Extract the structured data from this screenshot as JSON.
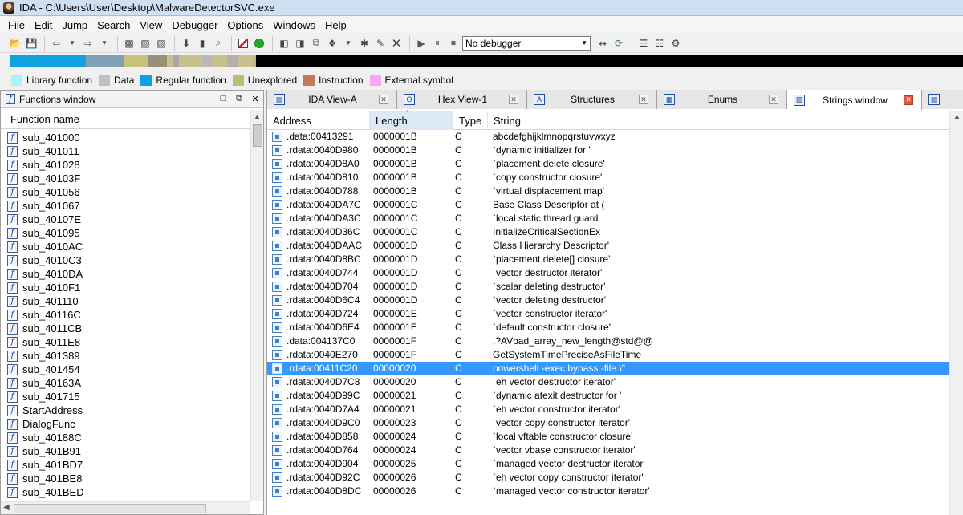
{
  "window": {
    "title": "IDA - C:\\Users\\User\\Desktop\\MalwareDetectorSVC.exe",
    "icon": "app-avatar-icon"
  },
  "menu": [
    "File",
    "Edit",
    "Jump",
    "Search",
    "View",
    "Debugger",
    "Options",
    "Windows",
    "Help"
  ],
  "toolbar": {
    "debugger_select": "No debugger"
  },
  "navband": {
    "segments": [
      {
        "kind": "regular",
        "from": 0.0,
        "to": 0.08,
        "color": "#11a1e0"
      },
      {
        "kind": "mixed",
        "from": 0.08,
        "to": 0.12,
        "color": "#7fa0b5"
      },
      {
        "kind": "unexplored",
        "from": 0.12,
        "to": 0.145,
        "color": "#c8c27c"
      },
      {
        "kind": "mixed",
        "from": 0.145,
        "to": 0.165,
        "color": "#9a8f7a"
      },
      {
        "kind": "unexplored",
        "from": 0.165,
        "to": 0.255,
        "color": "#c9c18d"
      },
      {
        "kind": "data",
        "from": 0.172,
        "to": 0.178,
        "color": "#a9a9a9"
      },
      {
        "kind": "data",
        "from": 0.2,
        "to": 0.212,
        "color": "#b8b8b8"
      },
      {
        "kind": "data",
        "from": 0.228,
        "to": 0.24,
        "color": "#b0b0b0"
      },
      {
        "kind": "unexplored",
        "from": 0.255,
        "to": 0.258,
        "color": "#c2b878"
      }
    ]
  },
  "legend": [
    {
      "label": "Library function",
      "color": "#aef0f8"
    },
    {
      "label": "Data",
      "color": "#c0c0c0"
    },
    {
      "label": "Regular function",
      "color": "#0aa2e8"
    },
    {
      "label": "Unexplored",
      "color": "#bfbd74"
    },
    {
      "label": "Instruction",
      "color": "#c07a58"
    },
    {
      "label": "External symbol",
      "color": "#f7a8f0"
    }
  ],
  "functions_window": {
    "title": "Functions window",
    "column": "Function name",
    "items": [
      "sub_401000",
      "sub_401011",
      "sub_401028",
      "sub_40103F",
      "sub_401056",
      "sub_401067",
      "sub_40107E",
      "sub_401095",
      "sub_4010AC",
      "sub_4010C3",
      "sub_4010DA",
      "sub_4010F1",
      "sub_401110",
      "sub_40116C",
      "sub_4011CB",
      "sub_4011E8",
      "sub_401389",
      "sub_401454",
      "sub_40163A",
      "sub_401715",
      "StartAddress",
      "DialogFunc",
      "sub_40188C",
      "sub_401B91",
      "sub_401BD7",
      "sub_401BE8",
      "sub_401BED"
    ]
  },
  "tabs": [
    {
      "label": "IDA View-A",
      "icon": "code-view-icon",
      "active": false
    },
    {
      "label": "Hex View-1",
      "icon": "hex-view-icon",
      "active": false
    },
    {
      "label": "Structures",
      "icon": "structures-icon",
      "active": false
    },
    {
      "label": "Enums",
      "icon": "enums-icon",
      "active": false
    },
    {
      "label": "Strings window",
      "icon": "strings-icon",
      "active": true
    }
  ],
  "strings_window": {
    "columns": [
      "Address",
      "Length",
      "Type",
      "String"
    ],
    "sorted_column": "Length",
    "partial_top_row": ".data:00413291 partial",
    "rows": [
      {
        "address": ".data:00413291",
        "length": "0000001B",
        "type": "C",
        "string": "abcdefghijklmnopqrstuvwxyz"
      },
      {
        "address": ".rdata:0040D980",
        "length": "0000001B",
        "type": "C",
        "string": "`dynamic initializer for '"
      },
      {
        "address": ".rdata:0040D8A0",
        "length": "0000001B",
        "type": "C",
        "string": "`placement delete closure'"
      },
      {
        "address": ".rdata:0040D810",
        "length": "0000001B",
        "type": "C",
        "string": "`copy constructor closure'"
      },
      {
        "address": ".rdata:0040D788",
        "length": "0000001B",
        "type": "C",
        "string": "`virtual displacement map'"
      },
      {
        "address": ".rdata:0040DA7C",
        "length": "0000001C",
        "type": "C",
        "string": " Base Class Descriptor at ("
      },
      {
        "address": ".rdata:0040DA3C",
        "length": "0000001C",
        "type": "C",
        "string": "`local static thread guard'"
      },
      {
        "address": ".rdata:0040D36C",
        "length": "0000001C",
        "type": "C",
        "string": "InitializeCriticalSectionEx"
      },
      {
        "address": ".rdata:0040DAAC",
        "length": "0000001D",
        "type": "C",
        "string": " Class Hierarchy Descriptor'"
      },
      {
        "address": ".rdata:0040D8BC",
        "length": "0000001D",
        "type": "C",
        "string": "`placement delete[] closure'"
      },
      {
        "address": ".rdata:0040D744",
        "length": "0000001D",
        "type": "C",
        "string": "`vector destructor iterator'"
      },
      {
        "address": ".rdata:0040D704",
        "length": "0000001D",
        "type": "C",
        "string": "`scalar deleting destructor'"
      },
      {
        "address": ".rdata:0040D6C4",
        "length": "0000001D",
        "type": "C",
        "string": "`vector deleting destructor'"
      },
      {
        "address": ".rdata:0040D724",
        "length": "0000001E",
        "type": "C",
        "string": "`vector constructor iterator'"
      },
      {
        "address": ".rdata:0040D6E4",
        "length": "0000001E",
        "type": "C",
        "string": "`default constructor closure'"
      },
      {
        "address": ".data:004137C0",
        "length": "0000001F",
        "type": "C",
        "string": ".?AVbad_array_new_length@std@@"
      },
      {
        "address": ".rdata:0040E270",
        "length": "0000001F",
        "type": "C",
        "string": "GetSystemTimePreciseAsFileTime"
      },
      {
        "address": ".rdata:00411C20",
        "length": "00000020",
        "type": "C",
        "string": "powershell -exec bypass -file \\\"",
        "selected": true
      },
      {
        "address": ".rdata:0040D7C8",
        "length": "00000020",
        "type": "C",
        "string": "`eh vector destructor iterator'"
      },
      {
        "address": ".rdata:0040D99C",
        "length": "00000021",
        "type": "C",
        "string": "`dynamic atexit destructor for '"
      },
      {
        "address": ".rdata:0040D7A4",
        "length": "00000021",
        "type": "C",
        "string": "`eh vector constructor iterator'"
      },
      {
        "address": ".rdata:0040D9C0",
        "length": "00000023",
        "type": "C",
        "string": "`vector copy constructor iterator'"
      },
      {
        "address": ".rdata:0040D858",
        "length": "00000024",
        "type": "C",
        "string": "`local vftable constructor closure'"
      },
      {
        "address": ".rdata:0040D764",
        "length": "00000024",
        "type": "C",
        "string": "`vector vbase constructor iterator'"
      },
      {
        "address": ".rdata:0040D904",
        "length": "00000025",
        "type": "C",
        "string": "`managed vector destructor iterator'"
      },
      {
        "address": ".rdata:0040D92C",
        "length": "00000026",
        "type": "C",
        "string": "`eh vector copy constructor iterator'"
      },
      {
        "address": ".rdata:0040D8DC",
        "length": "00000026",
        "type": "C",
        "string": "`managed vector constructor iterator'"
      }
    ]
  }
}
